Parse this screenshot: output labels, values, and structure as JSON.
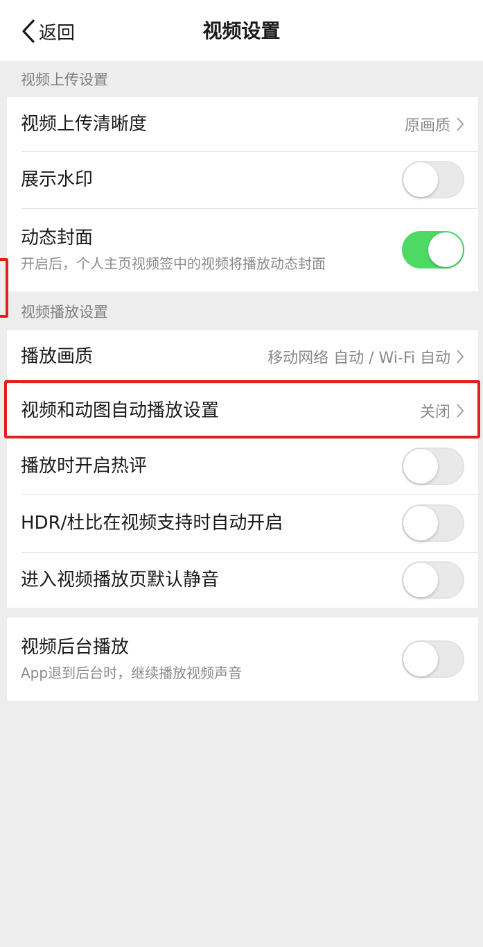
{
  "nav": {
    "back_label": "返回",
    "title": "视频设置"
  },
  "upload_section": {
    "header": "视频上传设置",
    "items": [
      {
        "title": "视频上传清晰度",
        "value": "原画质"
      },
      {
        "title": "展示水印",
        "toggle": false
      },
      {
        "title": "动态封面",
        "subtitle": "开启后，个人主页视频签中的视频将播放动态封面",
        "toggle": true
      }
    ]
  },
  "playback_section": {
    "header": "视频播放设置",
    "items": [
      {
        "title": "播放画质",
        "value": "移动网络 自动 / Wi-Fi 自动"
      },
      {
        "title": "视频和动图自动播放设置",
        "value": "关闭"
      },
      {
        "title": "播放时开启热评",
        "toggle": false
      },
      {
        "title": "HDR/杜比在视频支持时自动开启",
        "toggle": false
      },
      {
        "title": "进入视频播放页默认静音",
        "toggle": false
      }
    ]
  },
  "background_section": {
    "items": [
      {
        "title": "视频后台播放",
        "subtitle": "App退到后台时，继续播放视频声音",
        "toggle": false
      }
    ]
  },
  "colors": {
    "toggle_on": "#4cd964",
    "highlight": "#e0201e",
    "background": "#ededed"
  },
  "icons": {
    "back": "chevron-left-icon",
    "disclosure": "chevron-right-icon"
  }
}
